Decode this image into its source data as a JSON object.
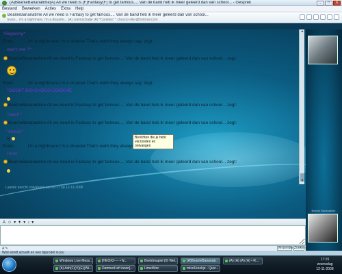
{
  "window": {
    "title": "(A)BeanieBananatime(A) All we need is (F)Fantasy(F) to get famous.... Van de band heb ik meer geleerd dan van school... - Gesprek",
    "controls": [
      "_",
      "□",
      "X"
    ]
  },
  "menu": [
    "Bestand",
    "Bewerken",
    "Acties",
    "Extra",
    "Help"
  ],
  "contact": {
    "name_line": "BeanieBananatime All we need is Fantasy to get famous.... Van de band heb ik meer geleerd dan van school...",
    "subline": "Evan... i'm a nightmare, i'm a disaster... (A) Joemschatje (A) *Cookies* * chocoo-vlier@hotmail.com"
  },
  "chat": {
    "rows": [
      {
        "kind": "tag",
        "text": "*Regening*"
      },
      {
        "kind": "nick",
        "name": "Evan.",
        "msg": "I'm a nightmare,i'm a disaster.That's wath they always say. zegt:"
      },
      {
        "kind": "tag",
        "text": "wan't one ?*"
      },
      {
        "kind": "nick",
        "name": "BeanieBananatime",
        "msg": "All we need is Fantasy to get famous.... Van de band heb ik meer geleerd dan van school... zegt:"
      },
      {
        "kind": "nick",
        "name": "Evan.",
        "msg": "I'm a nightmare,i'm a disaster.That's wath they always say. zegt:"
      },
      {
        "kind": "cookie",
        "text": "*GOOIIT BIG CHOCO-COOKIIIE"
      },
      {
        "kind": "nick",
        "name": "BeanieBananatime",
        "msg": "All we need is Fantasy to get famous.... Van de band heb ik meer geleerd dan van school... zegt:"
      },
      {
        "kind": "tag",
        "text": "*catch*"
      },
      {
        "kind": "nick",
        "name": "BeanieBananatime",
        "msg": "All we need is Fantasy to get famous.... Van de band heb ik meer geleerd dan van school... zegt:"
      },
      {
        "kind": "tag",
        "text": "*koesjh*"
      },
      {
        "kind": "tag",
        "text": "ty"
      },
      {
        "kind": "nick",
        "name": "Evan.",
        "msg": "I'm a nightmare,i'm a disaster.That's wath they always say. zegt:"
      },
      {
        "kind": "tag",
        "text": "Hmm"
      },
      {
        "kind": "nick",
        "name": "BeanieBananatime",
        "msg": "All we need is Fantasy to get famous.... Van de band heb ik meer geleerd dan van school... zegt:"
      }
    ],
    "tooltip": "Berichten die je hebt verzonden en ontvangen",
    "last_message": "Laatste bericht ontvangen om 20:17 op 12-11-2008"
  },
  "formatting": [
    "A",
    "☺",
    "▾",
    "✦",
    "▾",
    "♪",
    "▾"
  ],
  "input": {
    "value": ""
  },
  "footer": {
    "tabs": "A  ✎",
    "send": "Verzenden",
    "search": "Zoeken"
  },
  "side": {
    "label": "Beanie Bananatime"
  },
  "status": "Wist wordt actuelli en een bijprodel in jou",
  "taskbar": {
    "buttons": [
      "Windows Live Mess...",
      "[HEO#2---- • N...",
      "Beeldmapiel (0) Wel...",
      "(A)BeanieBananati...",
      "(A) (A) (A) (A) • R...",
      "(b) Ash(F)(V)(E)(Wi...",
      "Damned left kevin]...",
      "LimeWire",
      "miss1koekje - Quiz..."
    ],
    "time": "17:15",
    "day": "woensdag",
    "date": "12-11-2008"
  }
}
